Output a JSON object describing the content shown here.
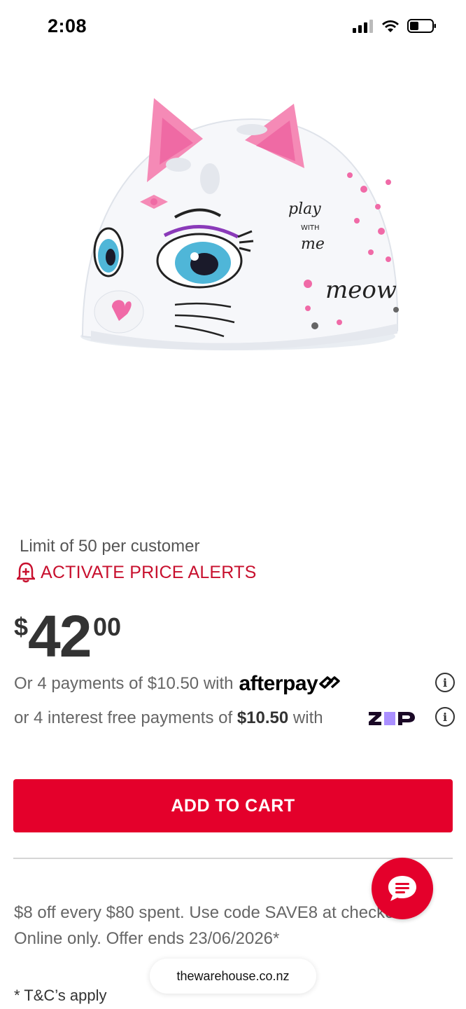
{
  "status_bar": {
    "time": "2:08"
  },
  "product": {
    "image_alt": "Kids white cat helmet with pink ears"
  },
  "limit_text": "Limit of 50 per customer",
  "price_alert": {
    "label": "ACTIVATE PRICE ALERTS",
    "icon": "bell-plus-icon"
  },
  "price": {
    "currency": "$",
    "dollars": "42",
    "cents": "00"
  },
  "afterpay": {
    "text": "Or 4 payments of $10.50 with",
    "logo_text": "afterpay"
  },
  "zip": {
    "text_prefix": "or 4 interest free payments of",
    "amount": "$10.50",
    "text_suffix": "with",
    "logo_text": "ZIP"
  },
  "add_to_cart_label": "ADD TO CART",
  "promo": {
    "line1": "$8 off every $80 spent. Use code SAVE8 at checkout.",
    "line2": "Online only. Offer ends 23/06/2026*"
  },
  "tc_text": "* T&C’s apply",
  "url_bar": {
    "domain": "thewarehouse.co.nz"
  },
  "colors": {
    "brand_red": "#e4002b",
    "alert_red": "#c8102e",
    "zip_purple": "#aa8fff"
  }
}
